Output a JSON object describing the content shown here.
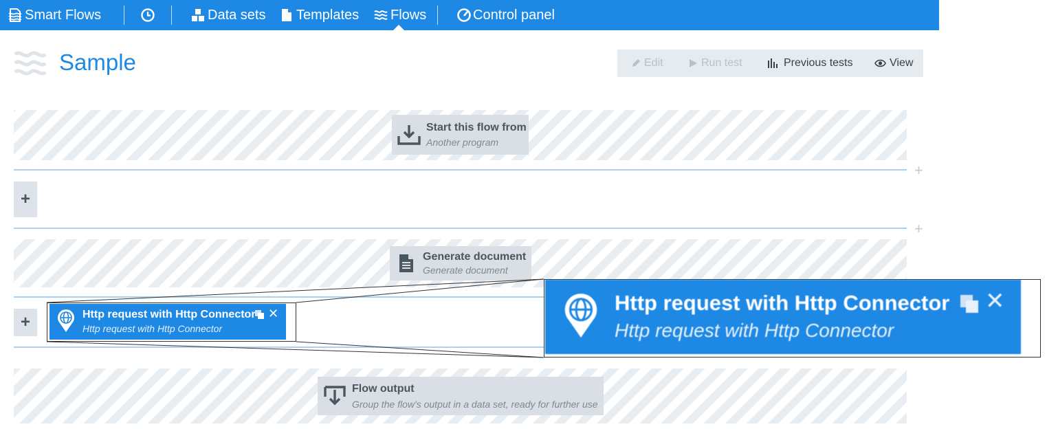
{
  "nav": {
    "brand": "Smart Flows",
    "items": [
      {
        "label": "Data sets",
        "icon": "datasets-icon"
      },
      {
        "label": "Templates",
        "icon": "file-icon"
      },
      {
        "label": "Flows",
        "icon": "waves-icon",
        "active": true
      },
      {
        "label": "Control panel",
        "icon": "gauge-icon"
      }
    ],
    "history_icon": "clock-icon",
    "bg_color": "#1e88e5"
  },
  "page": {
    "title": "Sample"
  },
  "toolbar": {
    "edit": "Edit",
    "run_test": "Run test",
    "previous_tests": "Previous tests",
    "view": "View"
  },
  "flow": {
    "start": {
      "title": "Start this flow from",
      "subtitle": "Another program"
    },
    "add_plus": "+",
    "line_plus": "+",
    "generate": {
      "title": "Generate document",
      "subtitle": "Generate document"
    },
    "http": {
      "title": "Http request with Http Connector",
      "subtitle": "Http request with Http Connector"
    },
    "output": {
      "title": "Flow output",
      "subtitle": "Group the flow's output in a data set, ready for further use"
    }
  },
  "zoom": {
    "title": "Http request with Http Connector",
    "subtitle": "Http request with Http Connector"
  },
  "colors": {
    "accent": "#1e88e5",
    "node_bg": "#d9dfe4",
    "line": "#a9d0f5"
  }
}
